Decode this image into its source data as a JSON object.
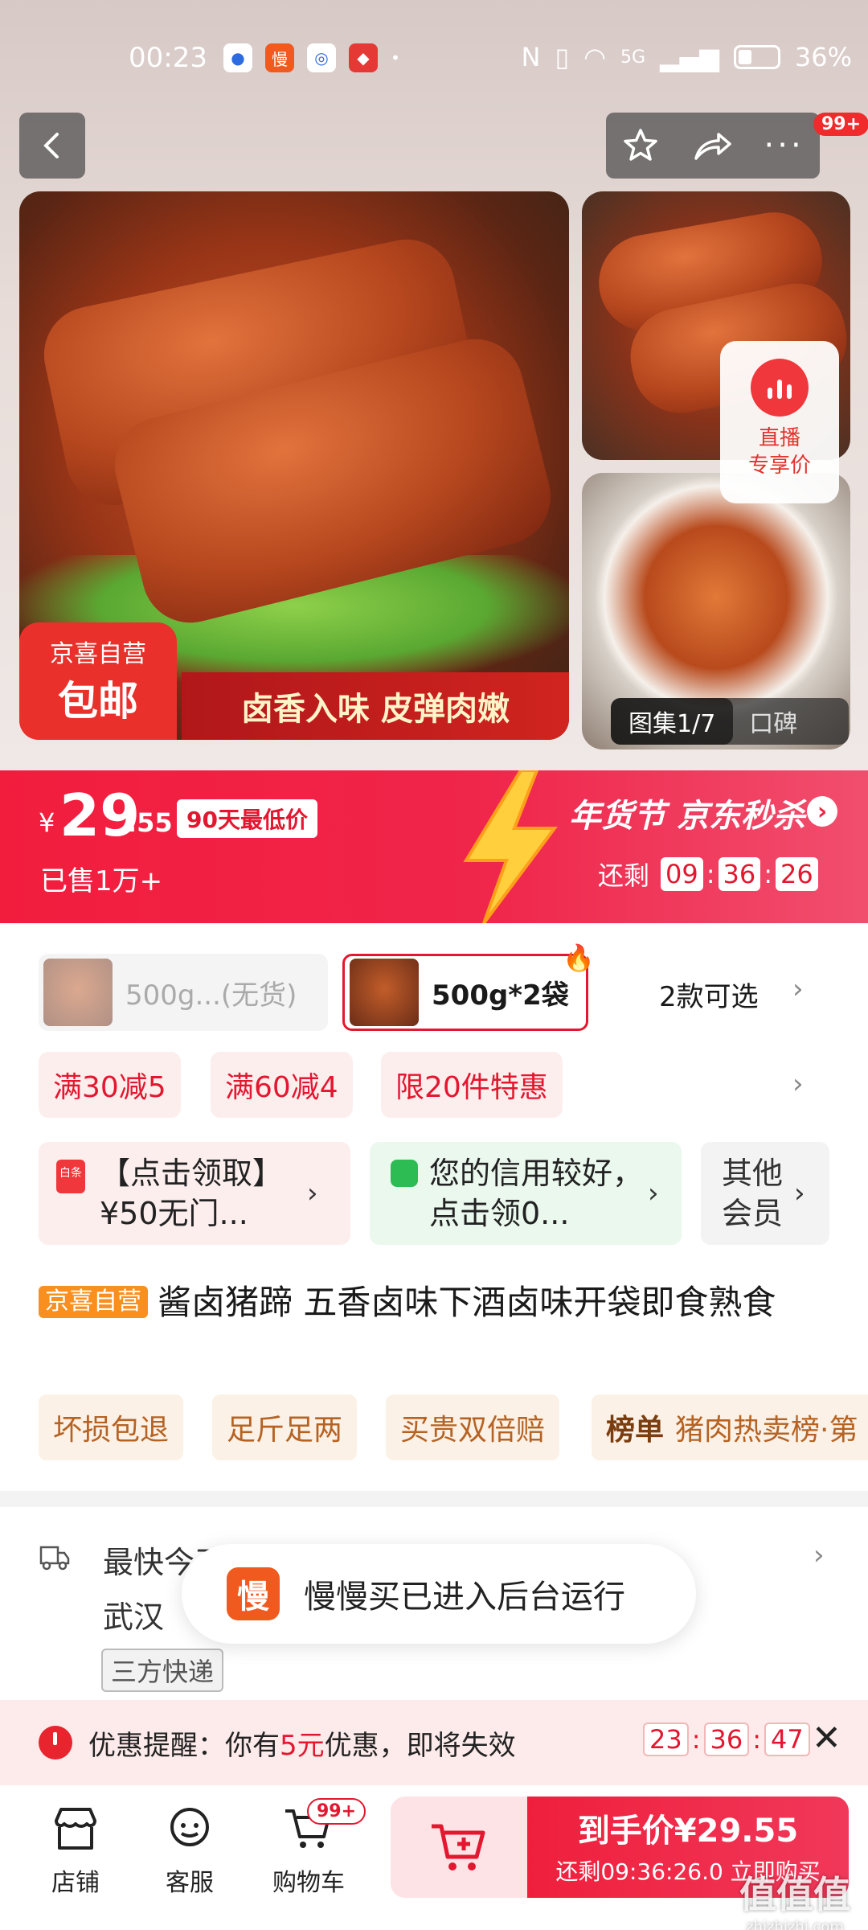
{
  "status_bar": {
    "time": "00:23",
    "battery": "36%",
    "network": "5G"
  },
  "nav": {
    "notif_badge": "99+"
  },
  "gallery": {
    "badge_top": "京喜自营",
    "badge_bottom": "包邮",
    "slogan": "卤香入味 皮弹肉嫩",
    "live_label_1": "直播",
    "live_label_2": "专享价",
    "gallery_count": "图集1/7",
    "reviews_tab": "口碑"
  },
  "price": {
    "currency": "¥",
    "integer": "29",
    "decimal": ".55",
    "lowest_tag": "90天最低价",
    "sold": "已售1万+",
    "event_title": "年货节 京东秒杀",
    "countdown_label": "还剩",
    "countdown": [
      "09",
      "36",
      "26"
    ]
  },
  "sku": {
    "option1": "500g...(无货)",
    "option2": "500g*2袋",
    "more": "2款可选"
  },
  "promos": [
    "满30减5",
    "满60减4",
    "限20件特惠"
  ],
  "coupons": {
    "c1_icon": "白条",
    "c1": "【点击领取】¥50无门...",
    "c2": "您的信用较好，点击领0...",
    "c3": "其他会员"
  },
  "product": {
    "tag": "京喜自营",
    "title": "酱卤猪蹄 五香卤味下酒卤味开袋即食熟食"
  },
  "services": [
    "坏损包退",
    "足斤足两",
    "买贵双倍赔"
  ],
  "rank": {
    "label": "榜单",
    "text": "猪肉热卖榜·第"
  },
  "delivery": {
    "line1": "最快今天发货",
    "line2": "武汉",
    "carrier": "三方快递"
  },
  "toast": {
    "icon": "慢",
    "text": "慢慢买已进入后台运行"
  },
  "reminder": {
    "prefix": "优惠提醒：你有",
    "amount": "5元",
    "suffix": "优惠，即将失效",
    "countdown": [
      "23",
      "36",
      "47"
    ]
  },
  "bottom_bar": {
    "store": "店铺",
    "service": "客服",
    "cart": "购物车",
    "cart_badge": "99+",
    "buy_title": "到手价¥29.55",
    "buy_sub": "还剩09:36:26.0 立即购买"
  },
  "watermark": {
    "main": "值值值",
    "sub": "zhizhizhi.com"
  },
  "colors": {
    "accent": "#f02442",
    "orange": "#f88f1f",
    "service_text": "#b66222"
  }
}
